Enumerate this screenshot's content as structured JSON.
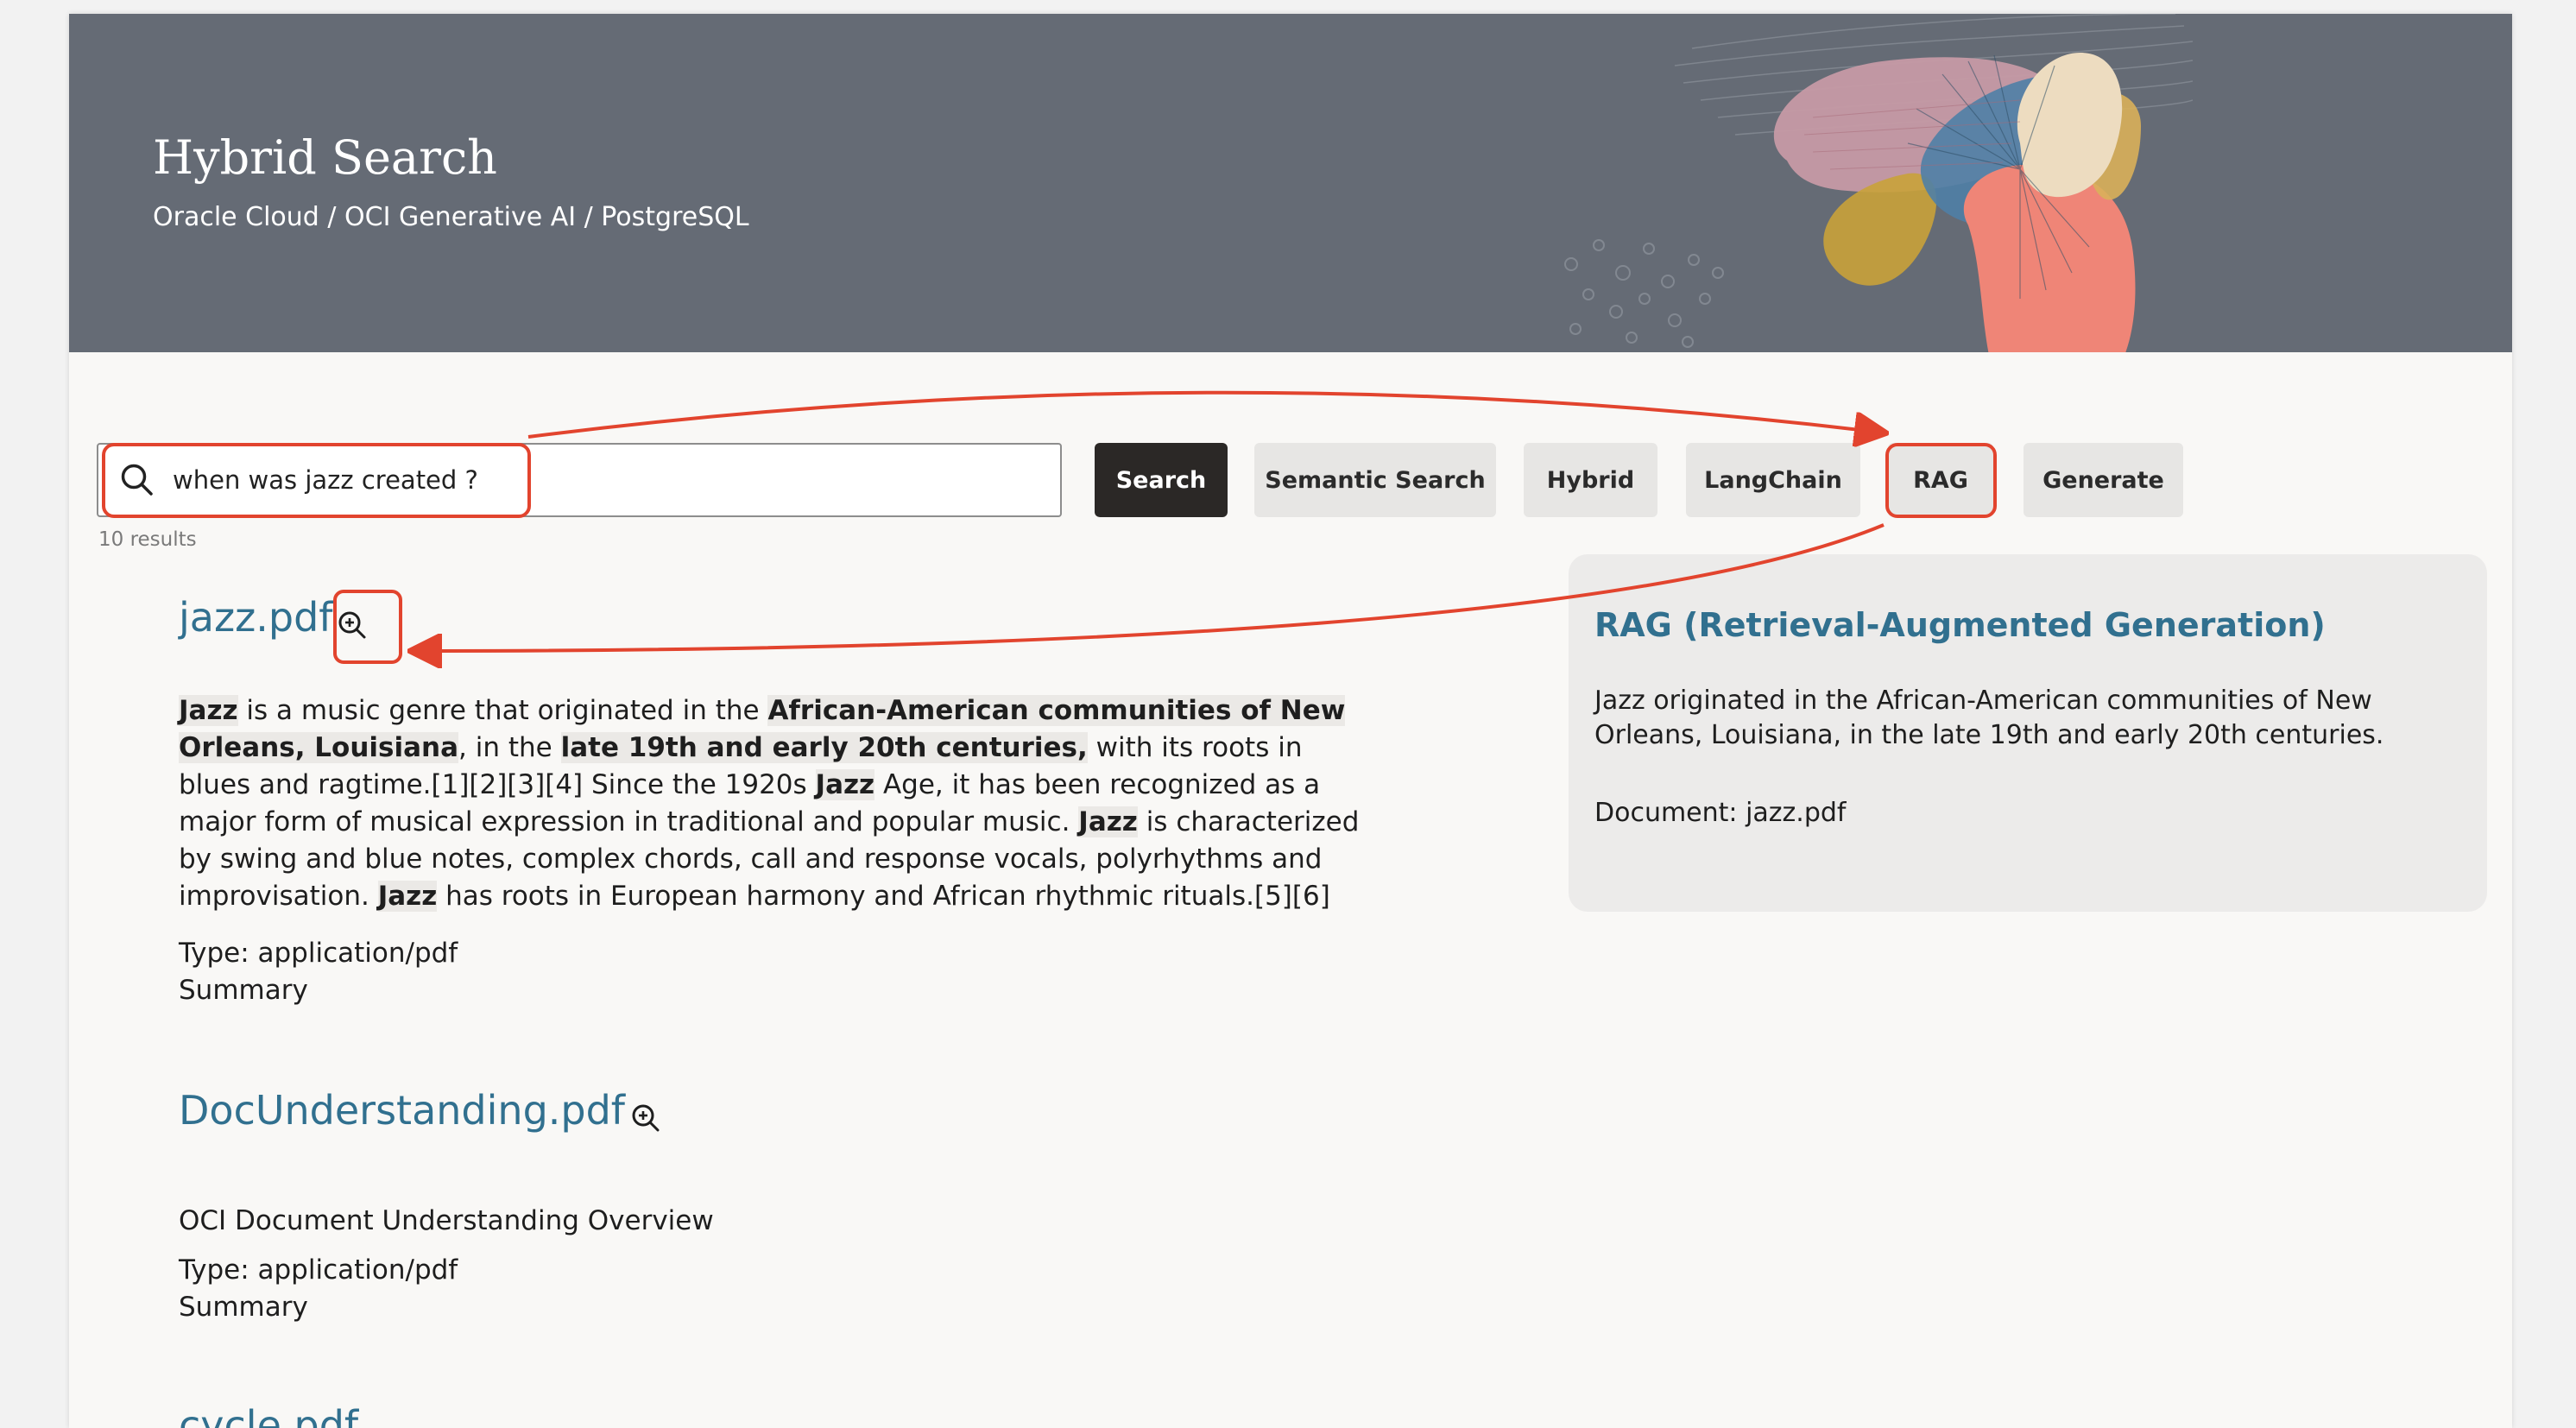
{
  "header": {
    "title": "Hybrid Search",
    "breadcrumb": "Oracle Cloud / OCI Generative AI / PostgreSQL"
  },
  "search": {
    "value": "when was jazz created ?",
    "results_count": "10 results"
  },
  "toolbar": {
    "search_label": "Search",
    "semantic_label": "Semantic Search",
    "hybrid_label": "Hybrid",
    "langchain_label": "LangChain",
    "rag_label": "RAG",
    "generate_label": "Generate"
  },
  "results": [
    {
      "title": "jazz.pdf",
      "snippet": [
        {
          "text": "Jazz",
          "bold": true
        },
        {
          "text": " is a music genre that originated in the ",
          "bold": false
        },
        {
          "text": "African-American communities of New Orleans, Louisiana",
          "bold": true
        },
        {
          "text": ", in the ",
          "bold": false
        },
        {
          "text": "late 19th and early 20th centuries,",
          "bold": true
        },
        {
          "text": " with its roots in blues and ragtime.[1][2][3][4] Since the 1920s ",
          "bold": false
        },
        {
          "text": "Jazz",
          "bold": true
        },
        {
          "text": " Age, it has been recognized as a major form of musical expression in traditional and popular music. ",
          "bold": false
        },
        {
          "text": "Jazz",
          "bold": true
        },
        {
          "text": " is characterized by swing and blue notes, complex chords, call and response vocals, polyrhythms and improvisation. ",
          "bold": false
        },
        {
          "text": "Jazz",
          "bold": true
        },
        {
          "text": " has roots in European harmony and African rhythmic rituals.[5][6]",
          "bold": false
        }
      ],
      "type": "Type: application/pdf",
      "summary": "Summary"
    },
    {
      "title": "DocUnderstanding.pdf",
      "description": "OCI Document Understanding Overview",
      "type": "Type: application/pdf",
      "summary": "Summary"
    },
    {
      "title": "cycle.pdf"
    }
  ],
  "rag": {
    "title": "RAG (Retrieval-Augmented Generation)",
    "answer": "Jazz originated in the African-American communities of New Orleans, Louisiana, in the late 19th and early 20th centuries.",
    "document": "Document: jazz.pdf"
  },
  "annotations": {
    "color": "#e2442e"
  },
  "icons": [
    "search-icon",
    "zoom-in-icon",
    "decorative-art"
  ]
}
